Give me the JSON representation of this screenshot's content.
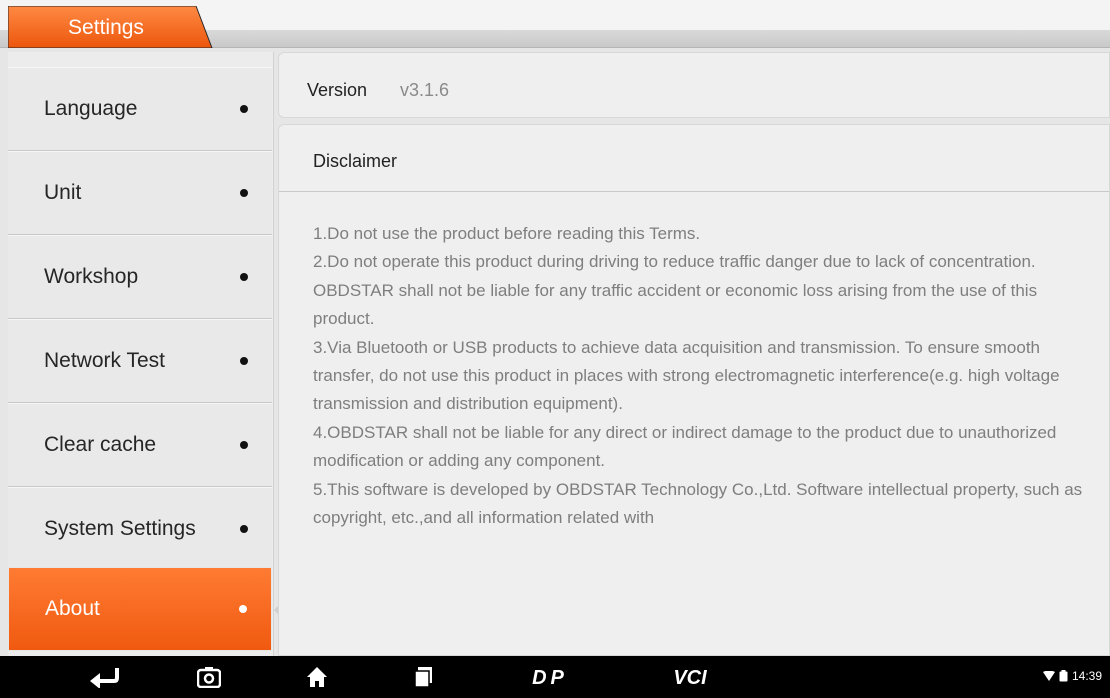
{
  "header": {
    "tab_title": "Settings"
  },
  "sidebar": {
    "items": [
      {
        "label": "Language"
      },
      {
        "label": "Unit"
      },
      {
        "label": "Workshop"
      },
      {
        "label": "Network Test"
      },
      {
        "label": "Clear cache"
      },
      {
        "label": "System Settings"
      },
      {
        "label": "About",
        "active": true
      }
    ]
  },
  "version": {
    "label": "Version",
    "value": "v3.1.6"
  },
  "disclaimer": {
    "title": "Disclaimer",
    "paragraphs": [
      "1.Do not use the product before reading this Terms.",
      "2.Do not operate this product during driving to reduce traffic danger due to lack of concentration. OBDSTAR shall not be liable for any traffic accident or economic loss arising from the use of this product.",
      "3.Via Bluetooth or USB products to achieve data acquisition and transmission. To ensure smooth transfer, do not use this product in places with strong electromagnetic interference(e.g. high voltage transmission and distribution equipment).",
      "4.OBDSTAR shall not be liable for any direct or indirect damage to the product due to unauthorized modification or adding any component.",
      "5.This software is developed by OBDSTAR Technology Co.,Ltd. Software intellectual property, such as copyright, etc.,and all information related with"
    ]
  },
  "navbar": {
    "buttons": [
      "back-icon",
      "screenshot-icon",
      "home-icon",
      "recent-apps-icon",
      "dp-logo-icon",
      "vci-icon"
    ],
    "dp_text": "DP",
    "vci_text": "VCI",
    "time": "14:39"
  },
  "colors": {
    "accent": "#f46a1f",
    "accent_dark": "#e2530f"
  }
}
